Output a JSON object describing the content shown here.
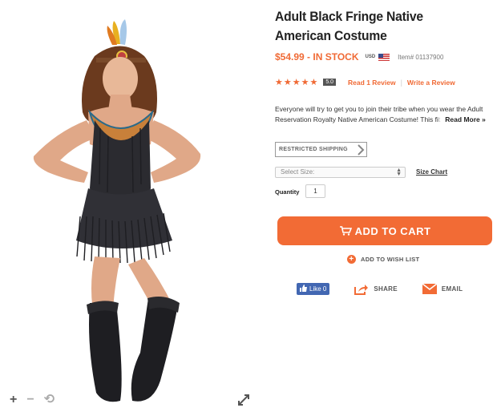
{
  "product": {
    "title": "Adult Black Fringe Native American Costume",
    "price": "$54.99 - IN STOCK",
    "currency": "USD",
    "item_number": "Item# 01137900",
    "stars": "★★★★★",
    "rating_score": "5.0",
    "read_reviews": "Read 1 Review",
    "separator": "|",
    "write_review": "Write a Review",
    "description_line1": "Everyone will try to get you to join their tribe when you wear the Adult",
    "description_line2": "Reservation Royalty Native American Costume! This fi",
    "description_fade": "t",
    "read_more": "Read More »"
  },
  "shipping": {
    "restricted_label": "RESTRICTED SHIPPING"
  },
  "options": {
    "size_placeholder": "Select Size:",
    "size_chart": "Size Chart",
    "quantity_label": "Quantity",
    "quantity_value": "1"
  },
  "actions": {
    "add_to_cart": "ADD TO CART",
    "wish_list": "ADD TO WISH LIST",
    "like": "Like 0",
    "share": "SHARE",
    "email": "EMAIL"
  },
  "viewer": {
    "zoom_in": "+",
    "zoom_out": "−",
    "reset": "⟲"
  },
  "colors": {
    "accent": "#f26b35",
    "facebook": "#4267b2"
  }
}
